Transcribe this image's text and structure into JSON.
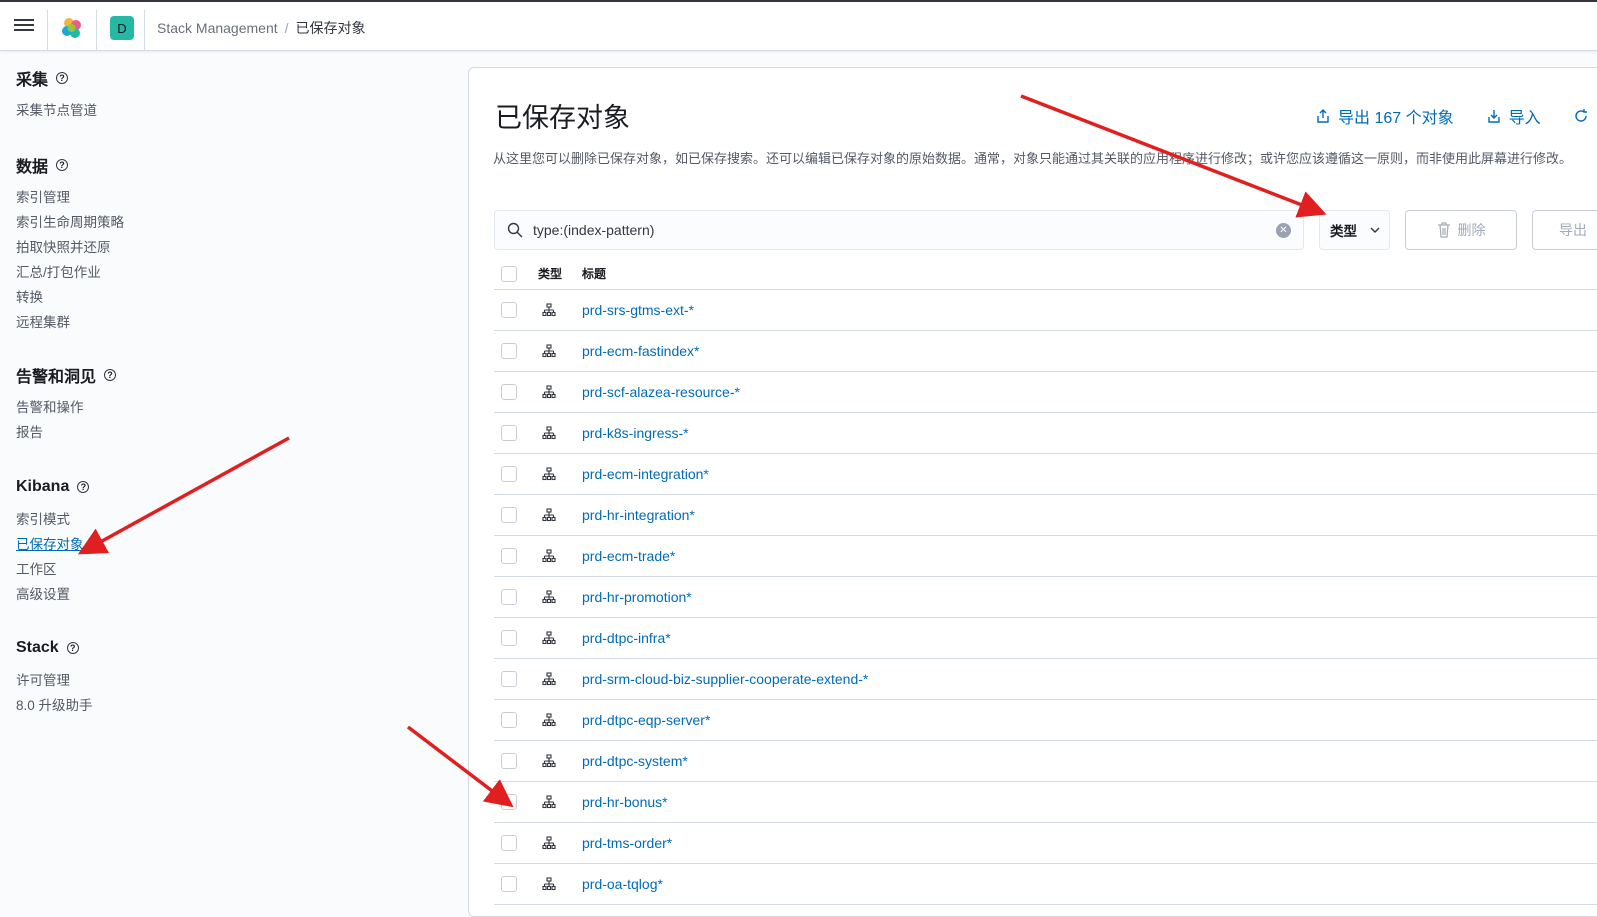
{
  "topbar": {
    "breadcrumbs": [
      "Stack Management",
      "已保存对象"
    ],
    "space_initial": "D"
  },
  "sidebar": {
    "sections": [
      {
        "title": "采集",
        "items": [
          "采集节点管道"
        ]
      },
      {
        "title": "数据",
        "items": [
          "索引管理",
          "索引生命周期策略",
          "拍取快照并还原",
          "汇总/打包作业",
          "转换",
          "远程集群"
        ]
      },
      {
        "title": "告警和洞见",
        "items": [
          "告警和操作",
          "报告"
        ]
      },
      {
        "title": "Kibana",
        "items": [
          "索引模式",
          "已保存对象",
          "工作区",
          "高级设置"
        ]
      },
      {
        "title": "Stack",
        "items": [
          "许可管理",
          "8.0 升级助手"
        ]
      }
    ],
    "active_item": "已保存对象"
  },
  "main": {
    "title": "已保存对象",
    "actions": {
      "export_all": "导出 167 个对象",
      "import": "导入"
    },
    "description": "从这里您可以删除已保存对象，如已保存搜索。还可以编辑已保存对象的原始数据。通常，对象只能通过其关联的应用程序进行修改；或许您应该遵循这一原则，而非使用此屏幕进行修改。",
    "search": {
      "value": "type:(index-pattern)"
    },
    "type_filter_label": "类型",
    "delete_label": "删除",
    "export_label": "导出",
    "table": {
      "headers": {
        "type": "类型",
        "title": "标题"
      },
      "rows": [
        "prd-srs-gtms-ext-*",
        "prd-ecm-fastindex*",
        "prd-scf-alazea-resource-*",
        "prd-k8s-ingress-*",
        "prd-ecm-integration*",
        "prd-hr-integration*",
        "prd-ecm-trade*",
        "prd-hr-promotion*",
        "prd-dtpc-infra*",
        "prd-srm-cloud-biz-supplier-cooperate-extend-*",
        "prd-dtpc-eqp-server*",
        "prd-dtpc-system*",
        "prd-hr-bonus*",
        "prd-tms-order*",
        "prd-oa-tqlog*"
      ]
    }
  },
  "colors": {
    "link": "#006bb8",
    "annotation_arrow": "#e02020",
    "space_badge": "#25b8a5"
  }
}
